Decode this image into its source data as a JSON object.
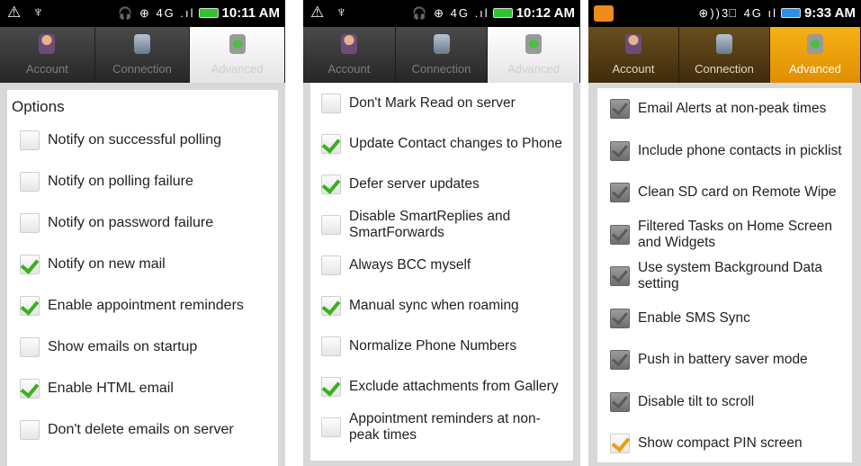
{
  "screens": [
    {
      "status": {
        "icons_left": "⚠ ♆",
        "icons_right": "🎧 ⊕ 4G .ıl",
        "time": "10:11 AM",
        "battery_color": "#2ec42e"
      },
      "tabs": [
        {
          "label": "Account",
          "icon": "person-icon",
          "selected": false
        },
        {
          "label": "Connection",
          "icon": "connection-icon",
          "selected": false
        },
        {
          "label": "Advanced",
          "icon": "gear-icon",
          "selected": true
        }
      ],
      "section_title": "Options",
      "items": [
        {
          "label": "Notify on successful polling",
          "checked": false
        },
        {
          "label": "Notify on polling failure",
          "checked": false
        },
        {
          "label": "Notify on password failure",
          "checked": false
        },
        {
          "label": "Notify on new mail",
          "checked": true
        },
        {
          "label": "Enable appointment reminders",
          "checked": true
        },
        {
          "label": "Show emails on startup",
          "checked": false
        },
        {
          "label": "Enable HTML email",
          "checked": true
        },
        {
          "label": "Don't delete emails on server",
          "checked": false
        }
      ]
    },
    {
      "status": {
        "icons_left": "⚠ ♆",
        "icons_right": "🎧 ⊕ 4G .ıl",
        "time": "10:12 AM",
        "battery_color": "#2ec42e"
      },
      "tabs": [
        {
          "label": "Account",
          "icon": "person-icon",
          "selected": false
        },
        {
          "label": "Connection",
          "icon": "connection-icon",
          "selected": false
        },
        {
          "label": "Advanced",
          "icon": "gear-icon",
          "selected": true
        }
      ],
      "items": [
        {
          "label": "Don't Mark Read on server",
          "checked": false
        },
        {
          "label": "Update Contact changes to Phone",
          "checked": true
        },
        {
          "label": "Defer server updates",
          "checked": true
        },
        {
          "label": "Disable SmartReplies and SmartForwards",
          "checked": false
        },
        {
          "label": "Always BCC myself",
          "checked": false
        },
        {
          "label": "Manual sync when roaming",
          "checked": true
        },
        {
          "label": "Normalize Phone Numbers",
          "checked": false
        },
        {
          "label": "Exclude attachments from Gallery",
          "checked": true
        },
        {
          "label": "Appointment reminders at non-peak times",
          "checked": false
        }
      ]
    },
    {
      "status": {
        "icons_left": "",
        "icons_right": "⊕))3⃞ 4G ıl",
        "time": "9:33 AM",
        "battery_color": "#2a8fe6"
      },
      "tabs": [
        {
          "label": "Account",
          "icon": "person-icon",
          "selected": false
        },
        {
          "label": "Connection",
          "icon": "connection-icon",
          "selected": false
        },
        {
          "label": "Advanced",
          "icon": "gear-icon",
          "selected": true
        }
      ],
      "items": [
        {
          "label": "Email Alerts at non-peak times",
          "checked": true
        },
        {
          "label": "Include phone contacts in picklist",
          "checked": true
        },
        {
          "label": "Clean SD card on Remote Wipe",
          "checked": true
        },
        {
          "label": "Filtered Tasks on Home Screen and Widgets",
          "checked": true
        },
        {
          "label": "Use system Background Data setting",
          "checked": true
        },
        {
          "label": "Enable SMS Sync",
          "checked": true
        },
        {
          "label": "Push in battery saver mode",
          "checked": true
        },
        {
          "label": "Disable tilt to scroll",
          "checked": true
        },
        {
          "label": "Show compact PIN screen",
          "checked": true
        }
      ]
    }
  ]
}
